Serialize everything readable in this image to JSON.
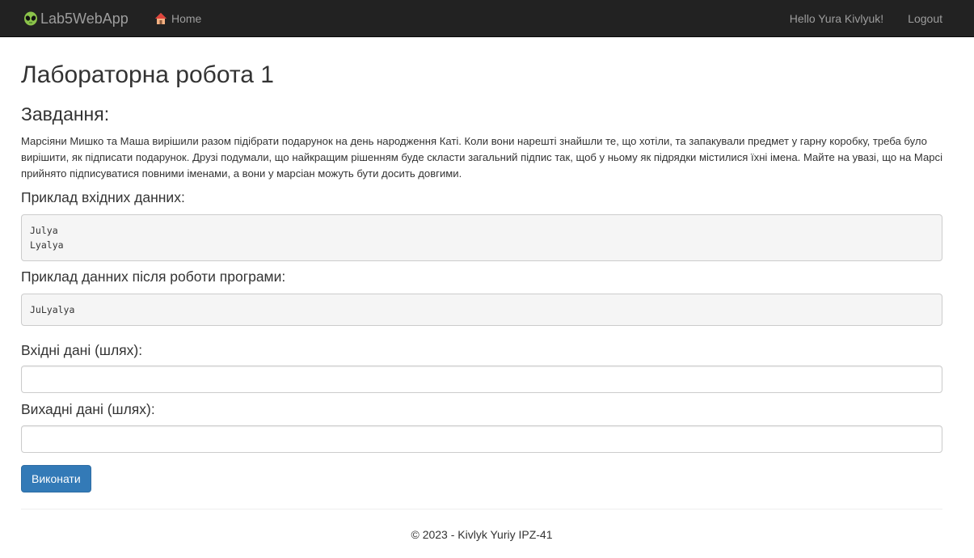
{
  "navbar": {
    "brand": "Lab5WebApp",
    "brand_icon": "alien-icon",
    "home_label": "Home",
    "home_icon": "house-icon",
    "greeting": "Hello Yura Kivlyuk!",
    "logout": "Logout"
  },
  "page": {
    "title": "Лабораторна робота 1",
    "task_heading": "Завдання:",
    "task_text": "Марсіяни Мишко та Маша вирішили разом підібрати подарунок на день народження Каті. Коли вони нарешті знайшли те, що хотіли, та запакували предмет у гарну коробку, треба було вирішити, як підписати подарунок. Друзі подумали, що найкращим рішенням буде скласти загальний підпис так, щоб у ньому як підрядки містилися їхні імена. Майте на увазі, що на Марсі прийнято підписуватися повними іменами, а вони у марсіан можуть бути досить довгими.",
    "input_example_label": "Приклад вхідних данних:",
    "input_example": "Julya\nLyalya",
    "output_example_label": "Приклад данних після роботи програми:",
    "output_example": "JuLyalya",
    "input_path_label": "Вхідні дані (шлях):",
    "input_path_value": "",
    "output_path_label": "Вихадні дані (шлях):",
    "output_path_value": "",
    "submit_label": "Виконати"
  },
  "footer": {
    "text": "© 2023 - Kivlyk Yuriy IPZ-41"
  },
  "colors": {
    "navbar_bg": "#222222",
    "nav_text": "#9d9d9d",
    "primary_button": "#337ab7"
  }
}
